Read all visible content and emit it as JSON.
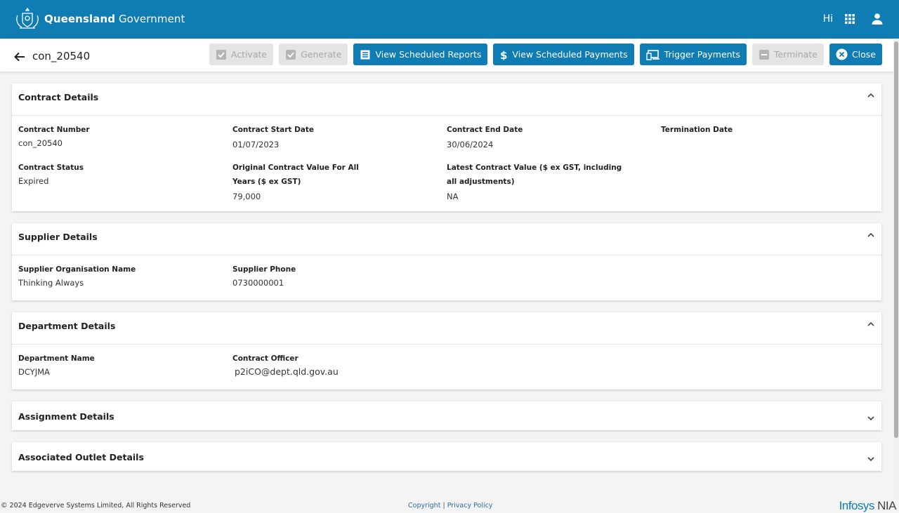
{
  "header": {
    "brand_bold": "Queensland",
    "brand_light": "Government",
    "greeting": "Hi",
    "apps_icon": "grid-icon",
    "user_icon": "person-icon"
  },
  "subheader": {
    "record_id": "con_20540",
    "buttons": {
      "activate": "Activate",
      "generate": "Generate",
      "view_reports": "View Scheduled Reports",
      "view_payments": "View Scheduled Payments",
      "trigger": "Trigger Payments",
      "terminate": "Terminate",
      "close": "Close"
    }
  },
  "contract": {
    "title": "Contract Details",
    "number_label": "Contract Number",
    "number": "con_20540",
    "start_label": "Contract Start Date",
    "start": "01/07/2023",
    "end_label": "Contract End Date",
    "end": "30/06/2024",
    "termination_label": "Termination Date",
    "termination": "",
    "status_label": "Contract Status",
    "status": "Expired",
    "original_label": "Original Contract Value For All Years ($ ex GST)",
    "original": "79,000",
    "latest_label": "Latest Contract Value ($ ex GST, including all adjustments)",
    "latest": "NA"
  },
  "supplier": {
    "title": "Supplier Details",
    "org_label": "Supplier Organisation Name",
    "org": "Thinking Always",
    "phone_label": "Supplier Phone",
    "phone": "0730000001"
  },
  "department": {
    "title": "Department Details",
    "name_label": "Department Name",
    "name": "DCYJMA",
    "officer_label": "Contract Officer",
    "officer": "p2iCO@dept.qld.gov.au"
  },
  "assignment": {
    "title": "Assignment Details"
  },
  "outlet": {
    "title": "Associated Outlet Details"
  },
  "footer": {
    "copyright": "© 2024 Edgeverve Systems Limited, All Rights Reserved",
    "link_copyright": "Copyright",
    "separator": "|",
    "link_privacy": "Privacy Policy",
    "logo_a": "Infosys",
    "logo_b": "NIA"
  },
  "colors": {
    "primary": "#0f7cb4",
    "disabled": "#e4e4e4"
  }
}
